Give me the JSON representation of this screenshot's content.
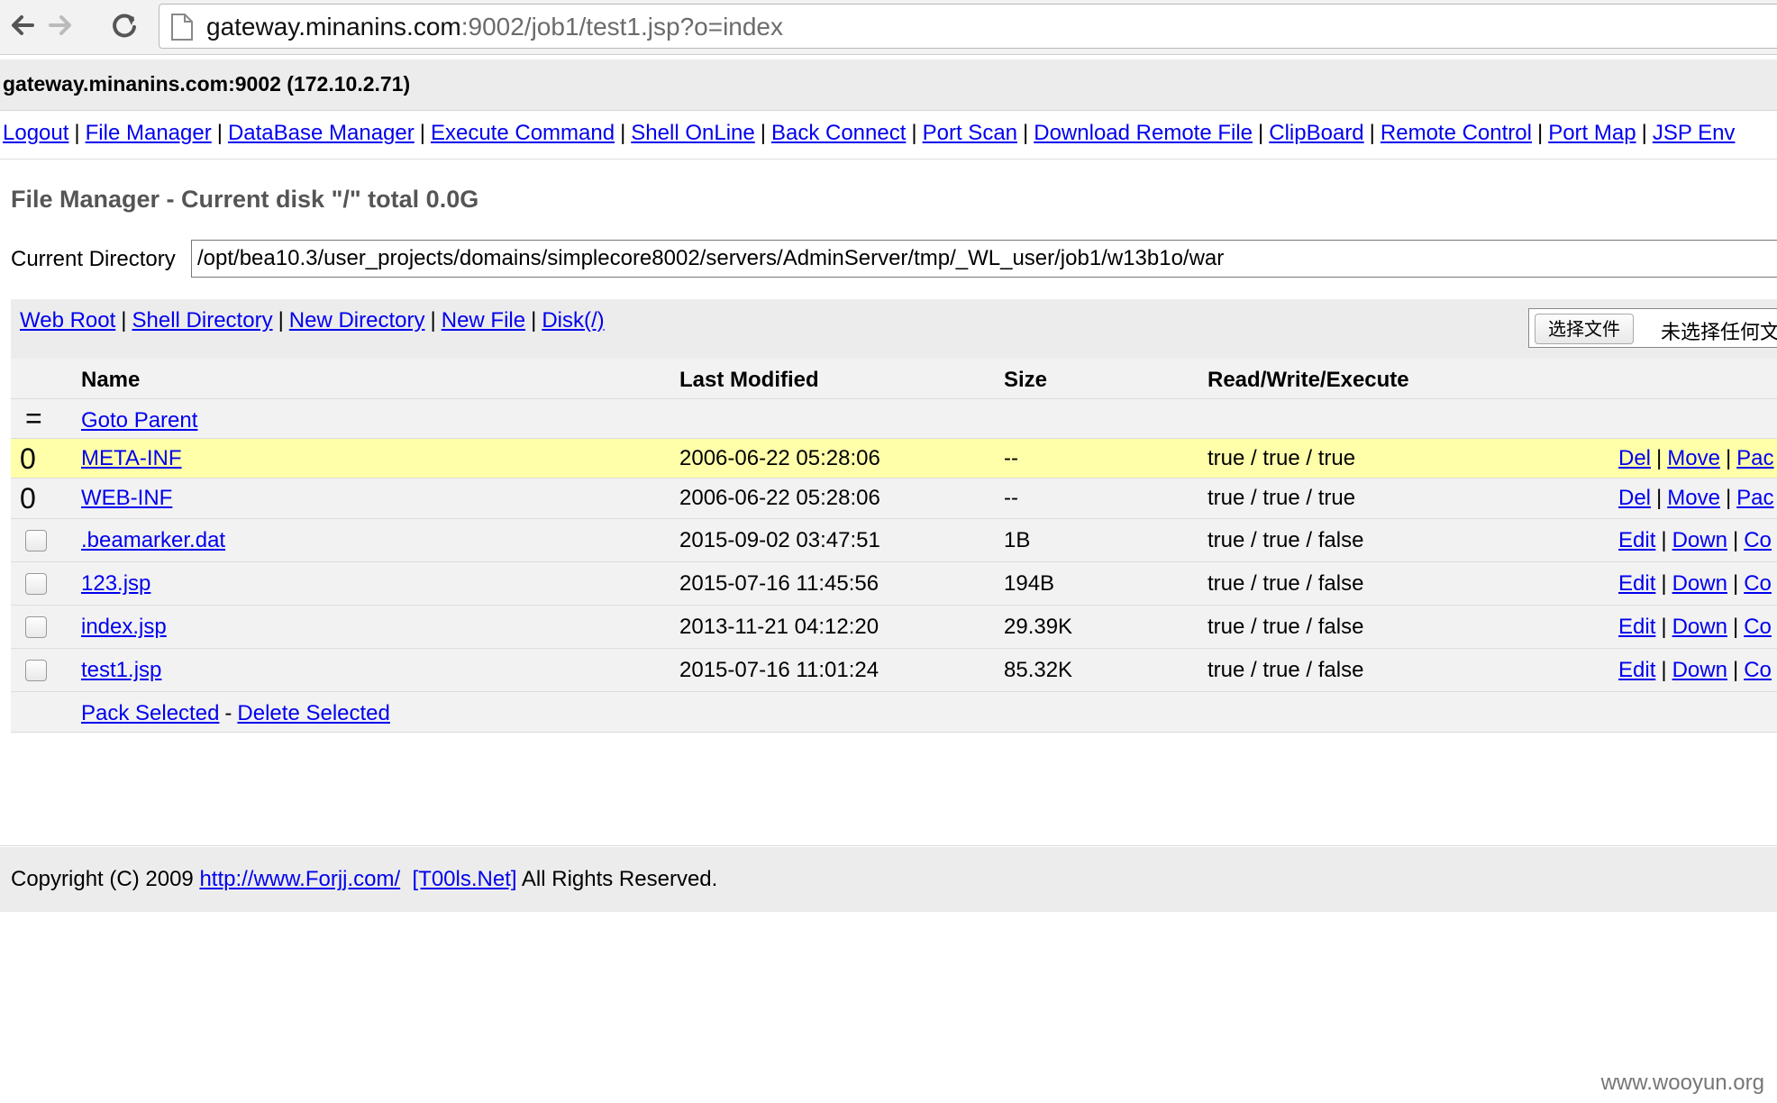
{
  "browser": {
    "url_host": "gateway.minanins.com",
    "url_rest": ":9002/job1/test1.jsp?o=index",
    "back_icon": "back-arrow-icon",
    "forward_icon": "forward-arrow-icon",
    "reload_icon": "reload-icon",
    "page_icon": "page-icon"
  },
  "host_info": "gateway.minanins.com:9002 (172.10.2.71)",
  "menu": [
    "Logout",
    "File Manager",
    "DataBase Manager",
    "Execute Command",
    "Shell OnLine",
    "Back Connect",
    "Port Scan",
    "Download Remote File",
    "ClipBoard",
    "Remote Control",
    "Port Map",
    "JSP Env"
  ],
  "page_title": "File Manager - Current disk \"/\" total 0.0G",
  "current_directory": {
    "label": "Current Directory",
    "value": "/opt/bea10.3/user_projects/domains/simplecore8002/servers/AdminServer/tmp/_WL_user/job1/w13b1o/war"
  },
  "toolbar_links": [
    "Web Root",
    "Shell Directory",
    "New Directory",
    "New File",
    "Disk(/)"
  ],
  "file_picker": {
    "button": "选择文件",
    "status": "未选择任何文"
  },
  "table": {
    "headers": [
      "Name",
      "Last Modified",
      "Size",
      "Read/Write/Execute"
    ],
    "parent": {
      "icon": "=",
      "label": "Goto Parent"
    },
    "rows": [
      {
        "icon": "0",
        "name": "META-INF",
        "modified": "2006-06-22 05:28:06",
        "size": "--",
        "rwx": "true / true / true",
        "actions": [
          "Del",
          "Move",
          "Pac"
        ]
      },
      {
        "icon": "0",
        "name": "WEB-INF",
        "modified": "2006-06-22 05:28:06",
        "size": "--",
        "rwx": "true / true / true",
        "actions": [
          "Del",
          "Move",
          "Pac"
        ]
      },
      {
        "icon": "",
        "name": ".beamarker.dat",
        "modified": "2015-09-02 03:47:51",
        "size": "1B",
        "rwx": "true / true / false",
        "actions": [
          "Edit",
          "Down",
          "Co"
        ]
      },
      {
        "icon": "",
        "name": "123.jsp",
        "modified": "2015-07-16 11:45:56",
        "size": "194B",
        "rwx": "true / true / false",
        "actions": [
          "Edit",
          "Down",
          "Co"
        ]
      },
      {
        "icon": "",
        "name": "index.jsp",
        "modified": "2013-11-21 04:12:20",
        "size": "29.39K",
        "rwx": "true / true / false",
        "actions": [
          "Edit",
          "Down",
          "Co"
        ]
      },
      {
        "icon": "",
        "name": "test1.jsp",
        "modified": "2015-07-16 11:01:24",
        "size": "85.32K",
        "rwx": "true / true / false",
        "actions": [
          "Edit",
          "Down",
          "Co"
        ]
      }
    ],
    "bulk": {
      "pack": "Pack Selected",
      "dash": "-",
      "delete": "Delete Selected"
    }
  },
  "footer": {
    "prefix": "Copyright (C) 2009",
    "link1": "http://www.Forjj.com/",
    "link2": "[T00ls.Net]",
    "suffix": "All Rights Reserved."
  },
  "watermark": "www.wooyun.org"
}
